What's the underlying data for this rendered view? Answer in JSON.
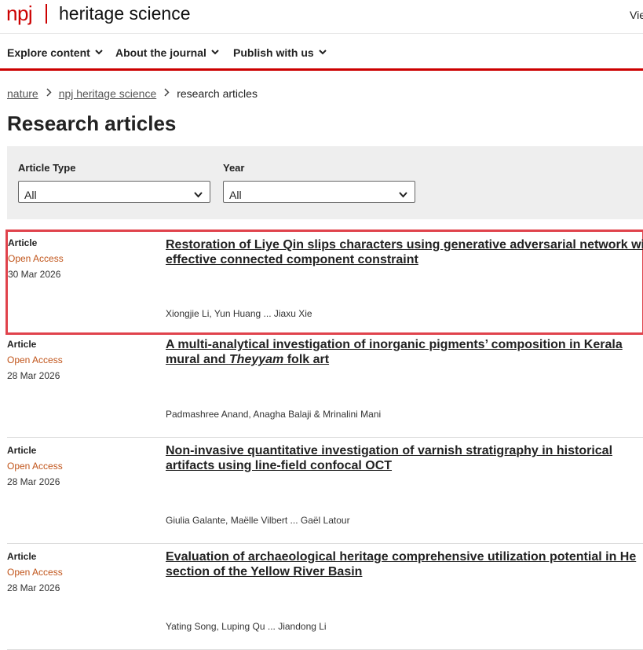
{
  "header": {
    "logo_mark": "npj",
    "journal_title": "heritage science",
    "view_link": "Vie"
  },
  "nav": {
    "items": [
      {
        "label": "Explore content"
      },
      {
        "label": "About the journal"
      },
      {
        "label": "Publish with us"
      }
    ]
  },
  "breadcrumb": {
    "items": [
      "nature",
      "npj heritage science"
    ],
    "current": "research articles"
  },
  "page": {
    "title": "Research articles"
  },
  "filters": {
    "article_type": {
      "label": "Article Type",
      "value": "All"
    },
    "year": {
      "label": "Year",
      "value": "All"
    }
  },
  "articles": [
    {
      "type": "Article",
      "access": "Open Access",
      "date": "30 Mar 2026",
      "title_line1": "Restoration of Liye Qin slips characters using generative adversarial network wi",
      "title_line2": "effective connected component constraint",
      "authors": "Xiongjie Li, Yun Huang ... Jiaxu Xie",
      "highlighted": true
    },
    {
      "type": "Article",
      "access": "Open Access",
      "date": "28 Mar 2026",
      "title_line1": "A multi-analytical investigation of inorganic pigments’ composition in Kerala",
      "title_line2_pre": "mural and ",
      "title_line2_em": "Theyyam",
      "title_line2_post": " folk art",
      "authors": "Padmashree Anand, Anagha Balaji & Mrinalini Mani"
    },
    {
      "type": "Article",
      "access": "Open Access",
      "date": "28 Mar 2026",
      "title_line1": "Non-invasive quantitative investigation of varnish stratigraphy in historical",
      "title_line2": "artifacts using line-field confocal OCT",
      "authors": "Giulia Galante, Maëlle Vilbert ... Gaël Latour"
    },
    {
      "type": "Article",
      "access": "Open Access",
      "date": "28 Mar 2026",
      "title_line1": "Evaluation of archaeological heritage comprehensive utilization potential in He",
      "title_line2": "section of the Yellow River Basin",
      "authors": "Yating Song, Luping Qu ... Jiandong Li"
    }
  ],
  "colors": {
    "brand_red": "#cc0000",
    "open_access": "#c1551b",
    "highlight_border": "#e0434c",
    "filter_panel": "#eeeeee"
  }
}
